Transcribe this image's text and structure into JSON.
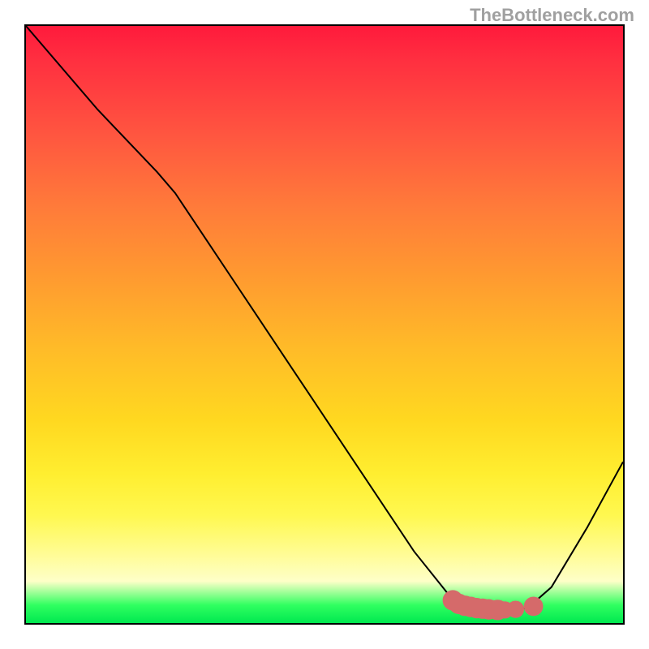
{
  "watermark": "TheBottleneck.com",
  "chart_data": {
    "type": "line",
    "title": "",
    "xlabel": "",
    "ylabel": "",
    "xlim": [
      0,
      100
    ],
    "ylim": [
      0,
      100
    ],
    "curve": [
      {
        "x": 0,
        "y": 100
      },
      {
        "x": 12,
        "y": 86
      },
      {
        "x": 22,
        "y": 75.5
      },
      {
        "x": 25,
        "y": 72
      },
      {
        "x": 35,
        "y": 57
      },
      {
        "x": 45,
        "y": 42
      },
      {
        "x": 55,
        "y": 27
      },
      {
        "x": 65,
        "y": 12
      },
      {
        "x": 71,
        "y": 4.5
      },
      {
        "x": 75,
        "y": 2.5
      },
      {
        "x": 80,
        "y": 2.2
      },
      {
        "x": 84,
        "y": 2.5
      },
      {
        "x": 88,
        "y": 6
      },
      {
        "x": 94,
        "y": 16
      },
      {
        "x": 100,
        "y": 27
      }
    ],
    "markers": [
      {
        "x": 71.5,
        "y": 3.8,
        "r": 1.3
      },
      {
        "x": 72.5,
        "y": 3.2,
        "r": 1.3
      },
      {
        "x": 73.5,
        "y": 2.9,
        "r": 1.3
      },
      {
        "x": 74.5,
        "y": 2.7,
        "r": 1.3
      },
      {
        "x": 75.5,
        "y": 2.5,
        "r": 1.3
      },
      {
        "x": 76.5,
        "y": 2.4,
        "r": 1.3
      },
      {
        "x": 77.5,
        "y": 2.3,
        "r": 1.3
      },
      {
        "x": 79.0,
        "y": 2.2,
        "r": 1.3
      },
      {
        "x": 80.2,
        "y": 2.2,
        "r": 1.0
      },
      {
        "x": 82.0,
        "y": 2.3,
        "r": 1.0
      },
      {
        "x": 85.0,
        "y": 2.8,
        "r": 1.2
      }
    ],
    "marker_color": "#d56a6a",
    "gradient_stops": [
      {
        "pos": 0.0,
        "color": "#ff1a3c"
      },
      {
        "pos": 0.5,
        "color": "#ffbb28"
      },
      {
        "pos": 0.85,
        "color": "#fff850"
      },
      {
        "pos": 0.97,
        "color": "#30ff60"
      },
      {
        "pos": 1.0,
        "color": "#00e850"
      }
    ]
  }
}
